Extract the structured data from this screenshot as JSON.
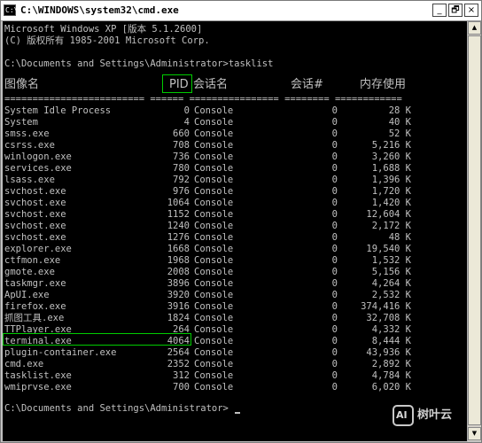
{
  "window": {
    "title": "C:\\WINDOWS\\system32\\cmd.exe",
    "icon_name": "cmd-icon",
    "minimize_label": "_",
    "restore_label": "🗗",
    "close_label": "×"
  },
  "console": {
    "banner_line1": "Microsoft Windows XP [版本 5.1.2600]",
    "banner_line2": "(C) 版权所有 1985-2001 Microsoft Corp.",
    "command_line": "C:\\Documents and Settings\\Administrator>tasklist",
    "headers": {
      "image_name": "图像名",
      "pid": "PID",
      "session_name": "会话名",
      "session_num": "会话#",
      "mem_usage": "内存使用"
    },
    "separator": "========================= ====== ================ ======== ============",
    "processes": [
      {
        "name": "System Idle Process",
        "pid": "0",
        "session": "Console",
        "num": "0",
        "mem": "28 K"
      },
      {
        "name": "System",
        "pid": "4",
        "session": "Console",
        "num": "0",
        "mem": "40 K"
      },
      {
        "name": "smss.exe",
        "pid": "660",
        "session": "Console",
        "num": "0",
        "mem": "52 K"
      },
      {
        "name": "csrss.exe",
        "pid": "708",
        "session": "Console",
        "num": "0",
        "mem": "5,216 K"
      },
      {
        "name": "winlogon.exe",
        "pid": "736",
        "session": "Console",
        "num": "0",
        "mem": "3,260 K"
      },
      {
        "name": "services.exe",
        "pid": "780",
        "session": "Console",
        "num": "0",
        "mem": "1,688 K"
      },
      {
        "name": "lsass.exe",
        "pid": "792",
        "session": "Console",
        "num": "0",
        "mem": "1,396 K"
      },
      {
        "name": "svchost.exe",
        "pid": "976",
        "session": "Console",
        "num": "0",
        "mem": "1,720 K"
      },
      {
        "name": "svchost.exe",
        "pid": "1064",
        "session": "Console",
        "num": "0",
        "mem": "1,420 K"
      },
      {
        "name": "svchost.exe",
        "pid": "1152",
        "session": "Console",
        "num": "0",
        "mem": "12,604 K"
      },
      {
        "name": "svchost.exe",
        "pid": "1240",
        "session": "Console",
        "num": "0",
        "mem": "2,172 K"
      },
      {
        "name": "svchost.exe",
        "pid": "1276",
        "session": "Console",
        "num": "0",
        "mem": "48 K"
      },
      {
        "name": "explorer.exe",
        "pid": "1668",
        "session": "Console",
        "num": "0",
        "mem": "19,540 K"
      },
      {
        "name": "ctfmon.exe",
        "pid": "1968",
        "session": "Console",
        "num": "0",
        "mem": "1,532 K"
      },
      {
        "name": "gmote.exe",
        "pid": "2008",
        "session": "Console",
        "num": "0",
        "mem": "5,156 K"
      },
      {
        "name": "taskmgr.exe",
        "pid": "3896",
        "session": "Console",
        "num": "0",
        "mem": "4,264 K"
      },
      {
        "name": "ApUI.exe",
        "pid": "3920",
        "session": "Console",
        "num": "0",
        "mem": "2,532 K"
      },
      {
        "name": "firefox.exe",
        "pid": "3916",
        "session": "Console",
        "num": "0",
        "mem": "374,416 K"
      },
      {
        "name": "抓图工具.exe",
        "pid": "1824",
        "session": "Console",
        "num": "0",
        "mem": "32,708 K"
      },
      {
        "name": "TTPlayer.exe",
        "pid": "264",
        "session": "Console",
        "num": "0",
        "mem": "4,332 K"
      },
      {
        "name": "terminal.exe",
        "pid": "4064",
        "session": "Console",
        "num": "0",
        "mem": "8,444 K"
      },
      {
        "name": "plugin-container.exe",
        "pid": "2564",
        "session": "Console",
        "num": "0",
        "mem": "43,936 K"
      },
      {
        "name": "cmd.exe",
        "pid": "2352",
        "session": "Console",
        "num": "0",
        "mem": "2,892 K"
      },
      {
        "name": "tasklist.exe",
        "pid": "312",
        "session": "Console",
        "num": "0",
        "mem": "4,784 K"
      },
      {
        "name": "wmiprvse.exe",
        "pid": "700",
        "session": "Console",
        "num": "0",
        "mem": "6,020 K"
      }
    ],
    "prompt": "C:\\Documents and Settings\\Administrator>"
  },
  "scrollbar": {
    "up_icon": "▲",
    "down_icon": "▼"
  },
  "watermark": {
    "logo_text": "AI",
    "brand_text": "树叶云"
  },
  "colors": {
    "terminal_bg": "#000000",
    "terminal_fg": "#c0c0c0",
    "highlight_box": "#00cc00"
  }
}
